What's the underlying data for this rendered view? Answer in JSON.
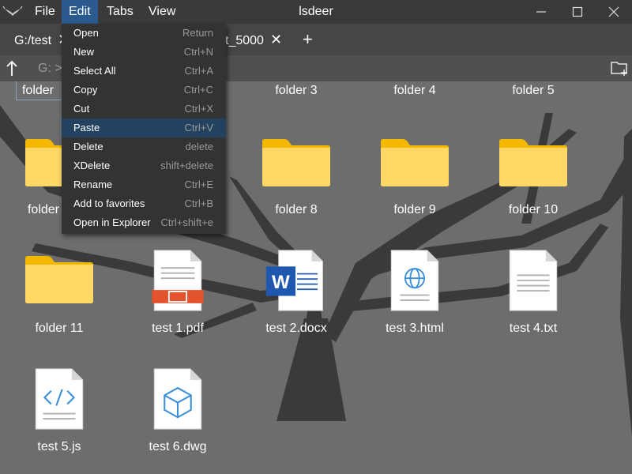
{
  "window": {
    "title": "lsdeer"
  },
  "menubar": [
    {
      "label": "File",
      "active": false
    },
    {
      "label": "Edit",
      "active": true
    },
    {
      "label": "Tabs",
      "active": false
    },
    {
      "label": "View",
      "active": false
    }
  ],
  "tabs": {
    "items": [
      {
        "label": "G:/test"
      },
      {
        "label": "t_5000"
      }
    ],
    "add_label": "+"
  },
  "address": {
    "value": "G: >"
  },
  "edit_menu": [
    {
      "label": "Open",
      "shortcut": "Return"
    },
    {
      "label": "New",
      "shortcut": "Ctrl+N"
    },
    {
      "label": "Select All",
      "shortcut": "Ctrl+A"
    },
    {
      "label": "Copy",
      "shortcut": "Ctrl+C"
    },
    {
      "label": "Cut",
      "shortcut": "Ctrl+X"
    },
    {
      "label": "Paste",
      "shortcut": "Ctrl+V",
      "highlighted": true
    },
    {
      "label": "Delete",
      "shortcut": "delete"
    },
    {
      "label": "XDelete",
      "shortcut": "shift+delete"
    },
    {
      "label": "Rename",
      "shortcut": "Ctrl+E"
    },
    {
      "label": "Add to favorites",
      "shortcut": "Ctrl+B"
    },
    {
      "label": "Open in Explorer",
      "shortcut": "Ctrl+shift+e"
    }
  ],
  "files": [
    {
      "name": "folder",
      "kind": "folder",
      "icon": "none",
      "partial": true
    },
    {
      "name": "folder 3",
      "kind": "folder",
      "icon": "none"
    },
    {
      "name": "folder 4",
      "kind": "folder",
      "icon": "none"
    },
    {
      "name": "folder 5",
      "kind": "folder",
      "icon": "none"
    },
    {
      "name": "folder",
      "kind": "folder",
      "icon": "folder-icon",
      "partial": true
    },
    {
      "name": "folder 8",
      "kind": "folder",
      "icon": "folder-icon"
    },
    {
      "name": "folder 9",
      "kind": "folder",
      "icon": "folder-icon"
    },
    {
      "name": "folder 10",
      "kind": "folder",
      "icon": "folder-icon"
    },
    {
      "name": "folder 11",
      "kind": "folder",
      "icon": "folder-icon"
    },
    {
      "name": "test 1.pdf",
      "kind": "file",
      "icon": "pdf-file-icon"
    },
    {
      "name": "test 2.docx",
      "kind": "file",
      "icon": "word-file-icon"
    },
    {
      "name": "test 3.html",
      "kind": "file",
      "icon": "html-file-icon"
    },
    {
      "name": "test 4.txt",
      "kind": "file",
      "icon": "text-file-icon"
    },
    {
      "name": "test 5.js",
      "kind": "file",
      "icon": "code-file-icon"
    },
    {
      "name": "test 6.dwg",
      "kind": "file",
      "icon": "cad-file-icon"
    }
  ],
  "colors": {
    "titlebar": "#3a3a3a",
    "menu_active": "#2a5a8e",
    "menu_bg": "#333333",
    "menu_highlight": "#23425f",
    "content_bg": "#6d6d6d",
    "folder": "#ffd866",
    "folder_tab": "#f5b800"
  }
}
